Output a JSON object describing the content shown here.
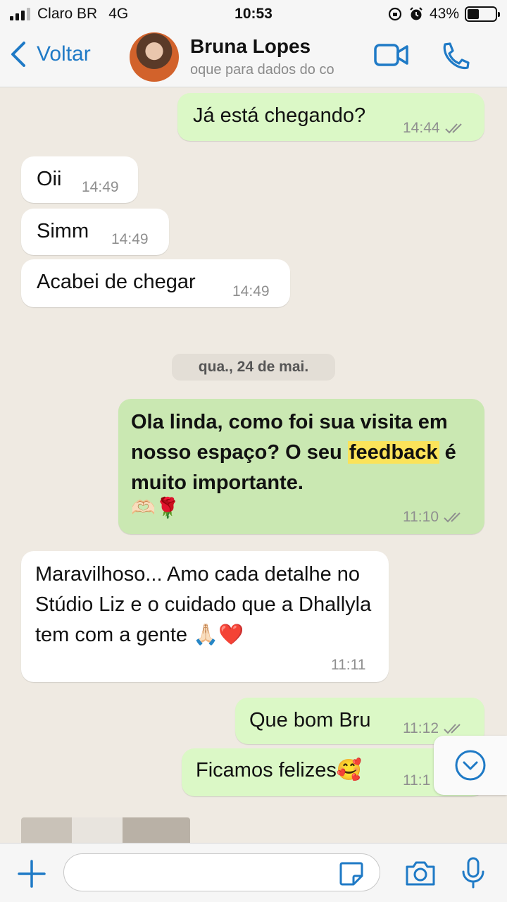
{
  "status_bar": {
    "carrier": "Claro BR",
    "network": "4G",
    "time": "10:53",
    "battery": "43%",
    "battery_level": 0.43
  },
  "header": {
    "back_label": "Voltar",
    "contact_name": "Bruna Lopes",
    "contact_subtitle": "oque para dados do co",
    "icons": [
      "chevron-left-icon",
      "video-call-icon",
      "phone-icon"
    ]
  },
  "messages": [
    {
      "dir": "out",
      "text": "Já está chegando?",
      "time": "14:44",
      "read": true
    },
    {
      "dir": "in",
      "text": "Oii",
      "time": "14:49"
    },
    {
      "dir": "in",
      "text": "Simm",
      "time": "14:49"
    },
    {
      "dir": "in",
      "text": "Acabei de chegar",
      "time": "14:49"
    },
    {
      "dir": "out",
      "text_before": "Ola linda, como foi sua visita em nosso espaço? O seu ",
      "highlight": "feedback",
      "text_after": " é muito importante.",
      "emoji": "🫶🏻🌹",
      "time": "11:10",
      "read": true
    },
    {
      "dir": "in",
      "text": "Maravilhoso... Amo cada detalhe no Stúdio Liz e o cuidado que a Dhallyla tem com a gente 🙏🏻❤️",
      "time": "11:11"
    },
    {
      "dir": "out",
      "text": "Que bom Bru",
      "time": "11:12",
      "read": true
    },
    {
      "dir": "out",
      "text": "Ficamos felizes🥰",
      "time": "11:1"
    }
  ],
  "date_separator": "qua., 24 de mai.",
  "input_bar": {
    "placeholder": "",
    "icons": [
      "plus-icon",
      "sticker-icon",
      "camera-icon",
      "microphone-icon"
    ]
  },
  "colors": {
    "accent": "#1f7ac6",
    "outgoing": "#dbf8c6",
    "incoming": "#ffffff",
    "highlight": "#fbe35a"
  }
}
